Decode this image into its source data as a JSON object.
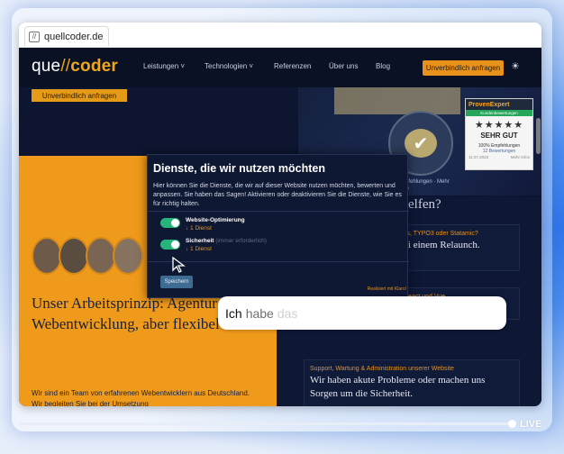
{
  "browser": {
    "tab_url": "quellcoder.de"
  },
  "site": {
    "logo": {
      "part1": "que",
      "slash": "//",
      "part2": "coder"
    },
    "menu": [
      "Leistungen",
      "Technologien",
      "Referenzen",
      "Über uns",
      "Blog"
    ],
    "menu_dropdown_marker": "˅",
    "cta_label": "Unverbindlich anfragen",
    "hero_button_label": "Unverbindlich anfragen",
    "hero_title": "Unser Arbeitsprinzip: Agentur für Webentwicklung, aber flexibel",
    "hero_body": "Wir sind ein Team von erfahrenen Webentwicklern aus Deutschland. Wir begleiten Sie bei der Umsetzung",
    "proven_expert_text": "Empfehlungen · Mehr Infos",
    "rating_widget": {
      "brand": "ProvenExpert",
      "subtitle": "Kundenbewertungen",
      "stars": "★★★★★",
      "grade": "SEHR GUT",
      "recommendation": "100% Empfehlungen",
      "reviews": "12 Bewertungen",
      "date": "11.07.2023",
      "more": "Mehr Infos"
    },
    "right_heading": "elfen?",
    "cards": [
      {
        "kicker": "ss, TYPO3 oder Statamic?",
        "title": "ei einem Relaunch."
      },
      {
        "kicker": "React und Vue",
        "title": ""
      },
      {
        "kicker": "Support, Wartung & Administration unserer Website",
        "title": "Wir haben akute Probleme oder machen uns Sorgen um die Sicherheit."
      }
    ]
  },
  "consent_modal": {
    "title": "Dienste, die wir nutzen möchten",
    "description": "Hier können Sie die Dienste, die wir auf dieser Website nutzen möchten, bewerten und anpassen. Sie haben das Sagen! Aktivieren oder deaktivieren Sie die Dienste, wie Sie es für richtig halten.",
    "services": [
      {
        "name": "Website-Optimierung",
        "note": "",
        "count": "↓ 1 Dienst",
        "enabled": true
      },
      {
        "name": "Sicherheit",
        "note": "(immer erforderlich)",
        "count": "↓ 1 Dienst",
        "enabled": true
      }
    ],
    "save_label": "Speichern",
    "footer": "Realisiert mit Klaro!"
  },
  "caption": {
    "words": [
      "Ich",
      "habe",
      "das"
    ]
  },
  "player": {
    "live_label": "LIVE",
    "progress": 1.0
  },
  "icons": {
    "theme_toggle": "sun-icon",
    "favicon": "page-icon",
    "cursor": "mouse-pointer-icon"
  },
  "colors": {
    "accent_orange": "#f09a1b",
    "navy": "#0d1530",
    "toggle_green": "#27b37b"
  }
}
